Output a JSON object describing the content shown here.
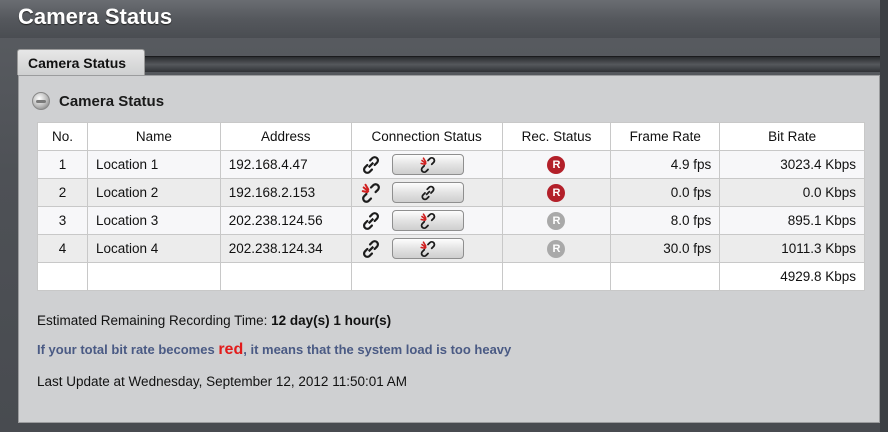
{
  "app": {
    "title": "Camera Status"
  },
  "tabs": [
    {
      "label": "Camera Status",
      "active": true
    }
  ],
  "section": {
    "title": "Camera Status",
    "icon": "globe-icon"
  },
  "table": {
    "columns": [
      "No.",
      "Name",
      "Address",
      "Connection Status",
      "Rec. Status",
      "Frame Rate",
      "Bit Rate"
    ],
    "rows": [
      {
        "no": "1",
        "name": "Location 1",
        "address": "192.168.4.47",
        "connected": true,
        "button_icon": "unlink-icon",
        "rec_label": "R",
        "rec_active": true,
        "frame_rate": "4.9 fps",
        "bit_rate": "3023.4 Kbps"
      },
      {
        "no": "2",
        "name": "Location 2",
        "address": "192.168.2.153",
        "connected": false,
        "button_icon": "link-icon",
        "rec_label": "R",
        "rec_active": true,
        "frame_rate": "0.0 fps",
        "bit_rate": "0.0 Kbps"
      },
      {
        "no": "3",
        "name": "Location 3",
        "address": "202.238.124.56",
        "connected": true,
        "button_icon": "unlink-icon",
        "rec_label": "R",
        "rec_active": false,
        "frame_rate": "8.0 fps",
        "bit_rate": "895.1 Kbps"
      },
      {
        "no": "4",
        "name": "Location 4",
        "address": "202.238.124.34",
        "connected": true,
        "button_icon": "unlink-icon",
        "rec_label": "R",
        "rec_active": false,
        "frame_rate": "30.0 fps",
        "bit_rate": "1011.3 Kbps"
      }
    ],
    "total_bit_rate": "4929.8 Kbps"
  },
  "recording": {
    "label": "Estimated Remaining Recording Time:",
    "value": "12 day(s) 1 hour(s)"
  },
  "note": {
    "before": "If your total bit rate becomes ",
    "highlight": "red",
    "after": ", it means that the system load is too heavy"
  },
  "last_update": "Last Update at Wednesday, September 12, 2012 11:50:01 AM",
  "colors": {
    "rec_active": "#b3202a",
    "rec_inactive": "#a9a9a9",
    "link_connected": "#1c1c1c",
    "link_broken_main": "#1c1c1c",
    "link_broken_mark": "#d01f1f"
  }
}
